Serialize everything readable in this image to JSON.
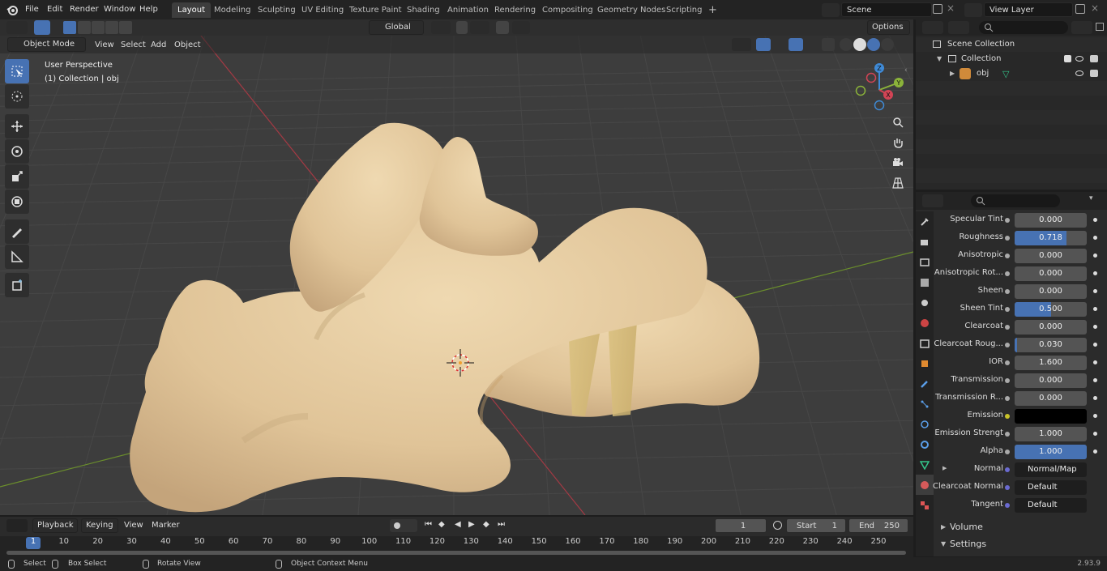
{
  "menu": {
    "items": [
      "File",
      "Edit",
      "Render",
      "Window",
      "Help"
    ]
  },
  "workspaces": [
    "Layout",
    "Modeling",
    "Sculpting",
    "UV Editing",
    "Texture Paint",
    "Shading",
    "Animation",
    "Rendering",
    "Compositing",
    "Geometry Nodes",
    "Scripting"
  ],
  "scene": {
    "name": "Scene",
    "view_layer": "View Layer"
  },
  "viewport": {
    "mode": "Object Mode",
    "menus": [
      "View",
      "Select",
      "Add",
      "Object"
    ],
    "transform": "Global",
    "options": "Options",
    "info_line1": "User Perspective",
    "info_line2": "(1) Collection | obj",
    "gizmo": {
      "z": "Z",
      "y": "Y",
      "x": "X"
    }
  },
  "outliner": {
    "root": "Scene Collection",
    "collection": "Collection",
    "object": "obj",
    "search_placeholder": ""
  },
  "properties": {
    "rows": [
      {
        "label": "Specular Tint",
        "value": "0.000",
        "fill": 0
      },
      {
        "label": "Roughness",
        "value": "0.718",
        "fill": 0.718
      },
      {
        "label": "Anisotropic",
        "value": "0.000",
        "fill": 0
      },
      {
        "label": "Anisotropic Rot...",
        "value": "0.000",
        "fill": 0
      },
      {
        "label": "Sheen",
        "value": "0.000",
        "fill": 0
      },
      {
        "label": "Sheen Tint",
        "value": "0.500",
        "fill": 0.5
      },
      {
        "label": "Clearcoat",
        "value": "0.000",
        "fill": 0
      },
      {
        "label": "Clearcoat Roug...",
        "value": "0.030",
        "fill": 0.03
      },
      {
        "label": "IOR",
        "value": "1.600",
        "fill": 0
      },
      {
        "label": "Transmission",
        "value": "0.000",
        "fill": 0
      },
      {
        "label": "Transmission R...",
        "value": "0.000",
        "fill": 0
      },
      {
        "label": "Emission",
        "value": "",
        "fill": 0
      },
      {
        "label": "Emission Strengt",
        "value": "1.000",
        "fill": 0
      },
      {
        "label": "Alpha",
        "value": "1.000",
        "fill": 1
      }
    ],
    "links": [
      {
        "label": "Normal",
        "value": "Normal/Map"
      },
      {
        "label": "Clearcoat Normal",
        "value": "Default"
      },
      {
        "label": "Tangent",
        "value": "Default"
      }
    ],
    "panels": [
      "Volume",
      "Settings"
    ]
  },
  "timeline": {
    "menus": [
      "Playback",
      "Keying",
      "View",
      "Marker"
    ],
    "current": "1",
    "start_label": "Start",
    "start": "1",
    "end_label": "End",
    "end": "250",
    "ticks": [
      "1",
      "10",
      "20",
      "30",
      "40",
      "50",
      "60",
      "70",
      "80",
      "90",
      "100",
      "110",
      "120",
      "130",
      "140",
      "150",
      "160",
      "170",
      "180",
      "190",
      "200",
      "210",
      "220",
      "230",
      "240",
      "250"
    ]
  },
  "status": {
    "select": "Select",
    "box_select": "Box Select",
    "rotate": "Rotate View",
    "context": "Object Context Menu",
    "version": "2.93.9"
  },
  "colors": {
    "accent": "#4772b3",
    "axis_x": "#d34455",
    "axis_y": "#8bb33a",
    "axis_z": "#3f8ad6",
    "mesh": "#e6cfa6"
  }
}
